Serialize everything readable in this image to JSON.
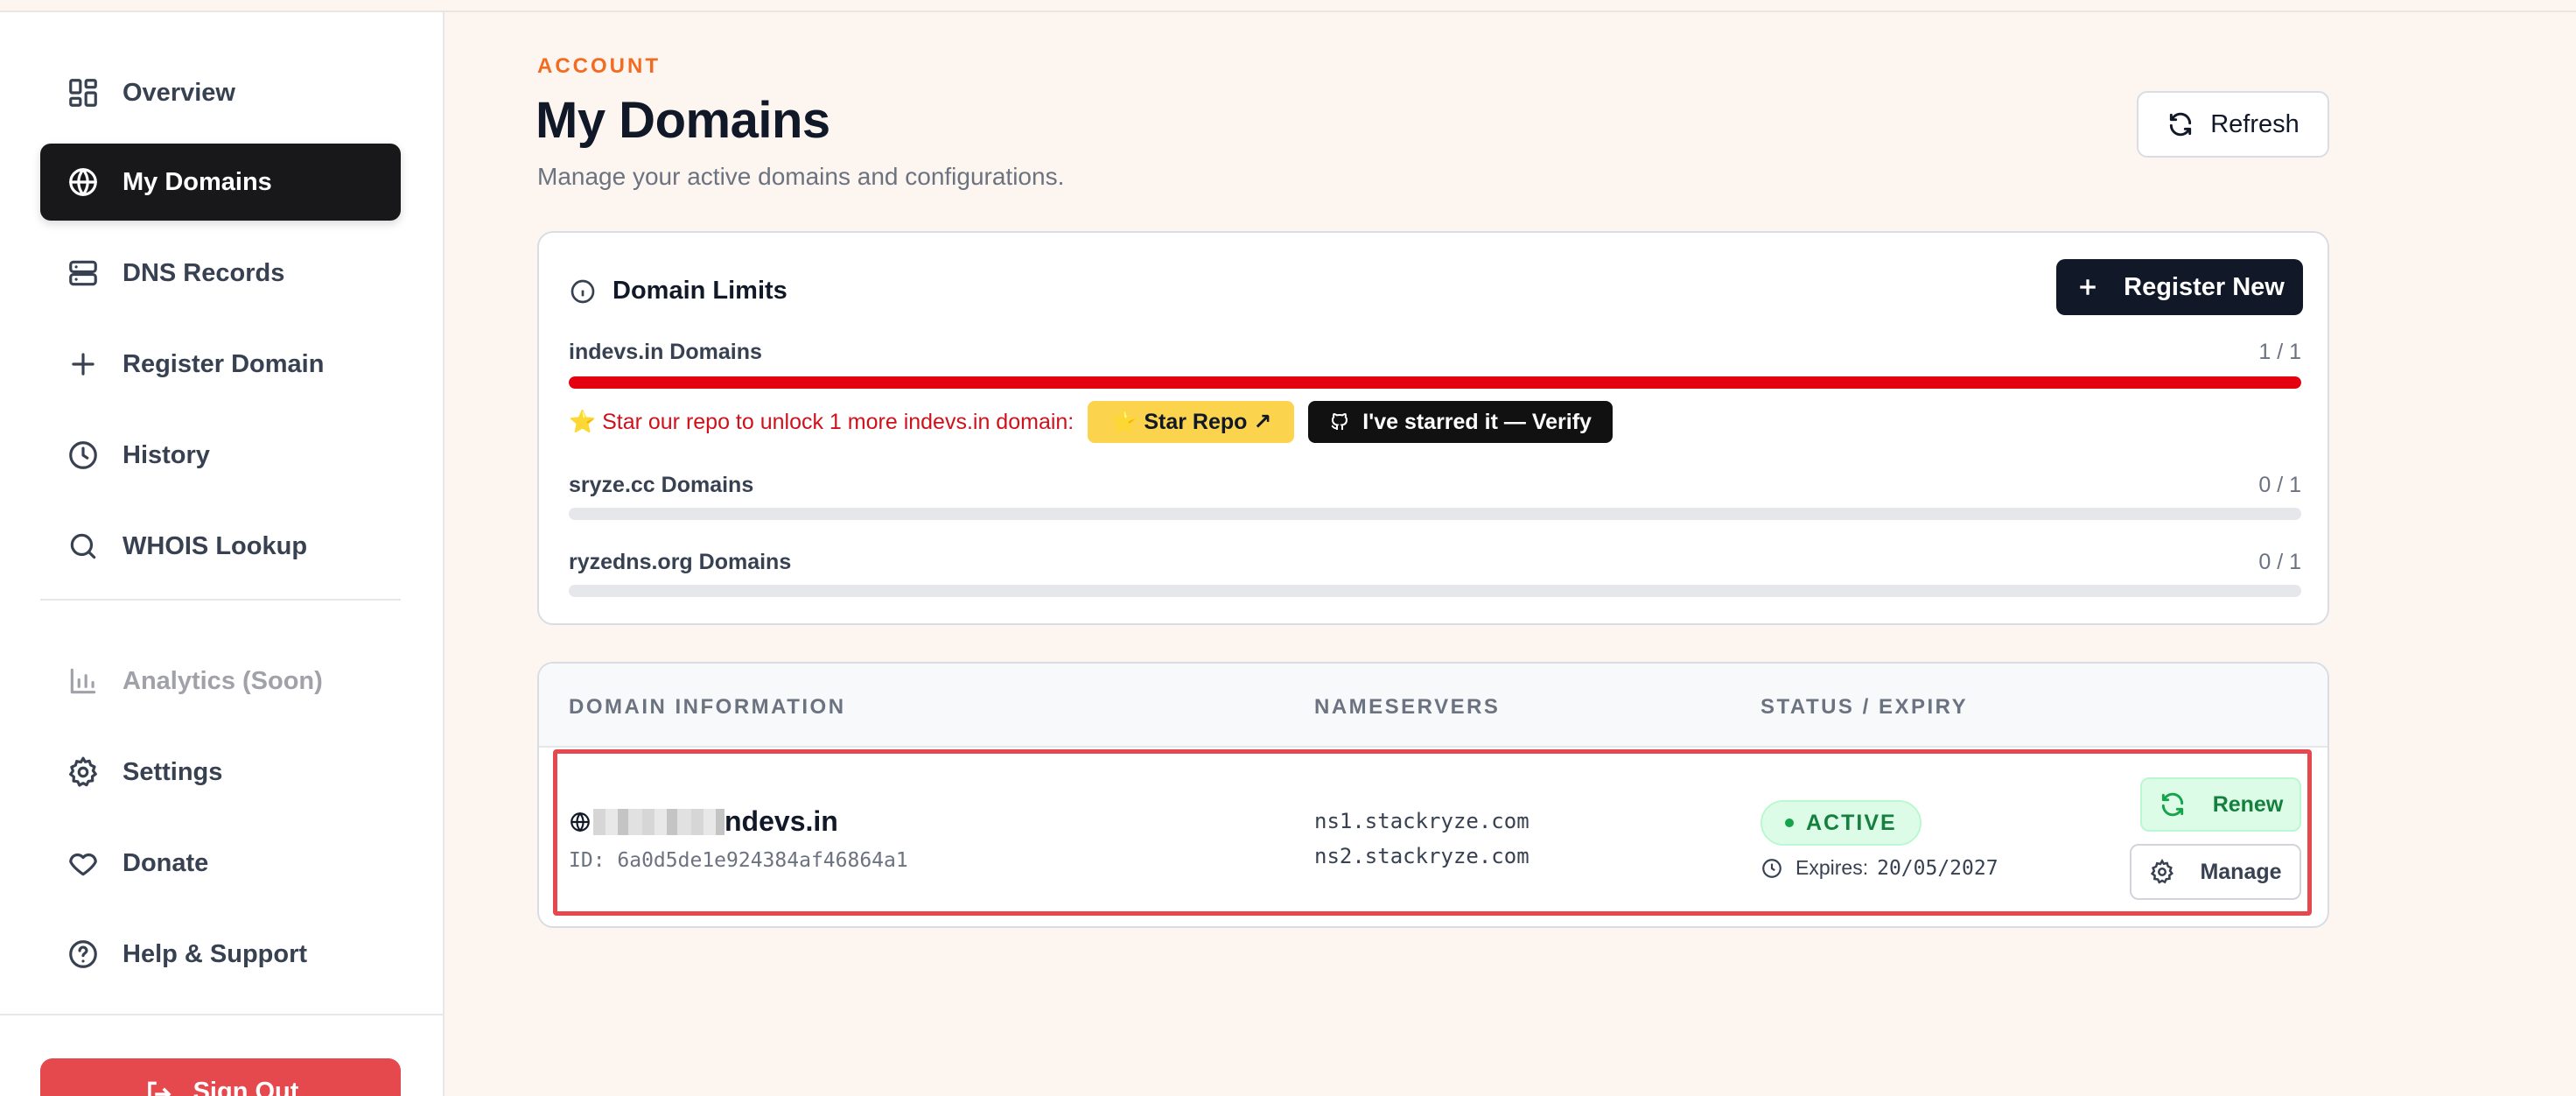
{
  "sidebar": {
    "items": [
      {
        "label": "Overview",
        "icon": "grid-icon"
      },
      {
        "label": "My Domains",
        "icon": "globe-icon",
        "active": true
      },
      {
        "label": "DNS Records",
        "icon": "server-icon"
      },
      {
        "label": "Register Domain",
        "icon": "plus-icon"
      },
      {
        "label": "History",
        "icon": "clock-icon"
      },
      {
        "label": "WHOIS Lookup",
        "icon": "search-icon"
      },
      {
        "label": "Analytics (Soon)",
        "icon": "bar-chart-icon",
        "disabled": true
      },
      {
        "label": "Settings",
        "icon": "gear-icon"
      },
      {
        "label": "Donate",
        "icon": "heart-icon"
      },
      {
        "label": "Help & Support",
        "icon": "help-circle-icon"
      }
    ],
    "sign_out": "Sign Out"
  },
  "header": {
    "eyebrow": "ACCOUNT",
    "title": "My Domains",
    "subtitle": "Manage your active domains and configurations.",
    "refresh_label": "Refresh"
  },
  "limits": {
    "title": "Domain Limits",
    "register_label": "Register New",
    "rows": [
      {
        "label": "indevs.in Domains",
        "count": "1 / 1",
        "used": 1,
        "max": 1
      },
      {
        "label": "sryze.cc Domains",
        "count": "0 / 1",
        "used": 0,
        "max": 1
      },
      {
        "label": "ryzedns.org Domains",
        "count": "0 / 1",
        "used": 0,
        "max": 1
      }
    ],
    "promo_text": "⭐ Star our repo to unlock 1 more indevs.in domain:",
    "star_label": "⭐ Star Repo ↗",
    "verify_label": "I've starred it — Verify"
  },
  "table": {
    "headers": [
      "DOMAIN INFORMATION",
      "NAMESERVERS",
      "STATUS / EXPIRY"
    ],
    "domain": {
      "name_suffix": "ndevs.in",
      "id": "ID: 6a0d5de1e924384af46864a1",
      "ns1": "ns1.stackryze.com",
      "ns2": "ns2.stackryze.com",
      "status": "ACTIVE",
      "expires_label": "Expires:",
      "expires_date": "20/05/2027",
      "renew_label": "Renew",
      "manage_label": "Manage"
    }
  },
  "colors": {
    "accent": "#f26b21",
    "danger": "#e5000f",
    "success": "#15803d",
    "dark": "#18181b"
  }
}
